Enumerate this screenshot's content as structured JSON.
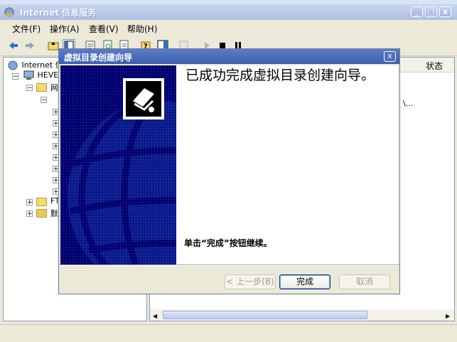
{
  "app": {
    "title": "Internet 信息服务",
    "buttons": {
      "minimize": "_",
      "maximize": "□",
      "close": "x"
    }
  },
  "menubar": {
    "items": [
      "文件(F)",
      "操作(A)",
      "查看(V)",
      "帮助(H)"
    ]
  },
  "toolbar": {
    "icons": [
      "back-arrow-icon",
      "forward-arrow-icon",
      "up-folder-icon",
      "show-tree-icon",
      "properties-icon",
      "refresh-icon",
      "export-icon",
      "help-icon",
      "console-icon",
      "disabled-icon",
      "play-icon",
      "stop-icon",
      "pause-icon"
    ]
  },
  "tree": {
    "root": "Internet 信",
    "server": "HEVER",
    "site": "网",
    "ftp": "FT",
    "default": "默"
  },
  "right_pane": {
    "status_column": "状态",
    "cell_fragment": "\\..."
  },
  "wizard": {
    "title": "虚拟目录创建向导",
    "close": "x",
    "heading": "已成功完成虚拟目录创建向导。",
    "hint": "单击“完成”按钮继续。",
    "buttons": {
      "back": "< 上一步(B)",
      "finish": "完成",
      "cancel": "取消"
    }
  },
  "colors": {
    "wizard_side": "#000070",
    "title_active": "#3c5fae"
  }
}
